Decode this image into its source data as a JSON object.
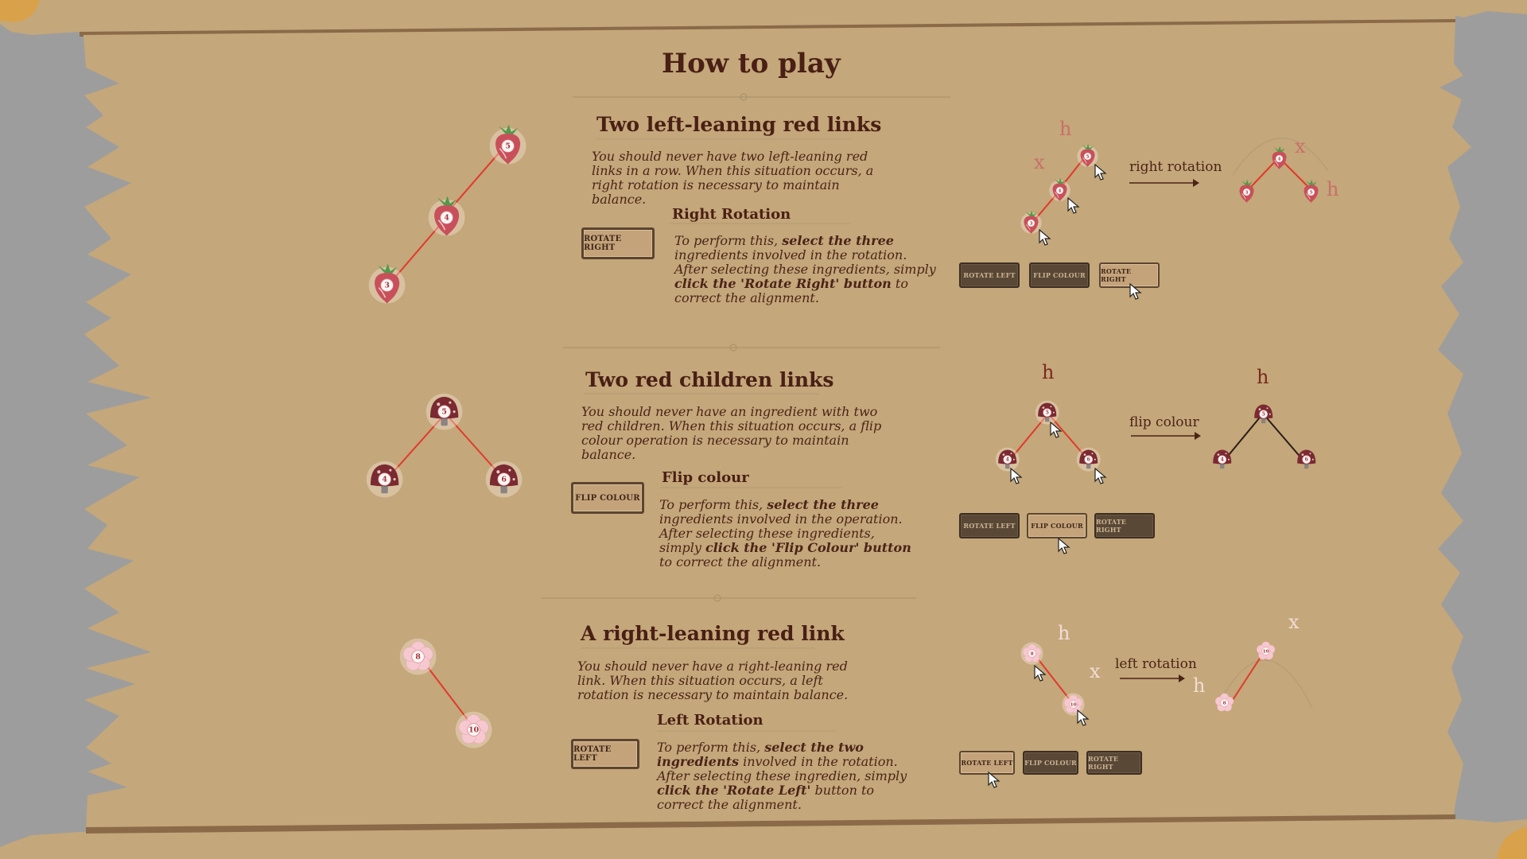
{
  "page": {
    "title": "How to play"
  },
  "sections": [
    {
      "heading": "Two left-leaning red links",
      "desc": "You should never have two left-leaning red links in a row. When this situation occurs, a right rotation is necessary to maintain balance.",
      "action_title": "Right Rotation",
      "button": "ROTATE RIGHT",
      "instr_1": "To perform this, ",
      "instr_b1": "select the three",
      "instr_2": " ingredients involved in the rotation. After selecting these ingredients, simply ",
      "instr_b2": "click the 'Rotate Right' button",
      "instr_3": " to correct the alignment.",
      "tree_nodes": [
        "5",
        "4",
        "3"
      ],
      "before_nodes": [
        "5",
        "4",
        "3"
      ],
      "after_nodes": [
        "4",
        "3",
        "5"
      ],
      "arrow_label": "right rotation",
      "letters": [
        "h",
        "x",
        "x",
        "h"
      ],
      "mini_buttons": [
        "ROTATE LEFT",
        "FLIP COLOUR",
        "ROTATE RIGHT"
      ]
    },
    {
      "heading": "Two red children links",
      "desc": "You should never have an ingredient with two red children. When this situation occurs, a flip colour operation is necessary to maintain balance.",
      "action_title": "Flip colour",
      "button": "FLIP COLOUR",
      "instr_1": "To perform this, ",
      "instr_b1": "select the three",
      "instr_2": " ingredients involved in the operation. After selecting these ingredients, simply ",
      "instr_b2": "click the 'Flip Colour' button",
      "instr_3": " to correct the alignment.",
      "tree_nodes": [
        "5",
        "4",
        "6"
      ],
      "before_nodes": [
        "5",
        "4",
        "6"
      ],
      "after_nodes": [
        "5",
        "4",
        "6"
      ],
      "arrow_label": "flip colour",
      "letters": [
        "h",
        "h"
      ],
      "mini_buttons": [
        "ROTATE LEFT",
        "FLIP COLOUR",
        "ROTATE RIGHT"
      ]
    },
    {
      "heading": "A right-leaning red link",
      "desc": "You should never have a right-leaning red link. When this situation occurs, a left rotation is necessary to maintain balance.",
      "action_title": "Left Rotation",
      "button": "ROTATE LEFT",
      "instr_1": "To perform this, ",
      "instr_b1": "select the two ingredients",
      "instr_2": " involved in the rotation. After selecting these ingredien, simply ",
      "instr_b2": "click the 'Rotate Left'",
      "instr_3": " button to correct the alignment.",
      "tree_nodes": [
        "8",
        "10"
      ],
      "before_nodes": [
        "8",
        "10"
      ],
      "after_nodes": [
        "10",
        "8"
      ],
      "arrow_label": "left rotation",
      "letters": [
        "h",
        "x",
        "x",
        "h"
      ],
      "mini_buttons": [
        "ROTATE LEFT",
        "FLIP COLOUR",
        "ROTATE RIGHT"
      ]
    }
  ],
  "colors": {
    "parchment": "#c4a77a",
    "border": "#9d9d9d",
    "text": "#4a2418",
    "red_link": "#e03a2c",
    "black_link": "#2a1c16",
    "beet": "#c8505a",
    "leaf": "#4e9a4a",
    "mushroom": "#7a2a30",
    "blossom": "#f0b8c0",
    "accent_corner": "#d9a24a"
  },
  "icons": [
    "beetroot-icon",
    "mushroom-icon",
    "blossom-icon",
    "cursor-icon"
  ]
}
